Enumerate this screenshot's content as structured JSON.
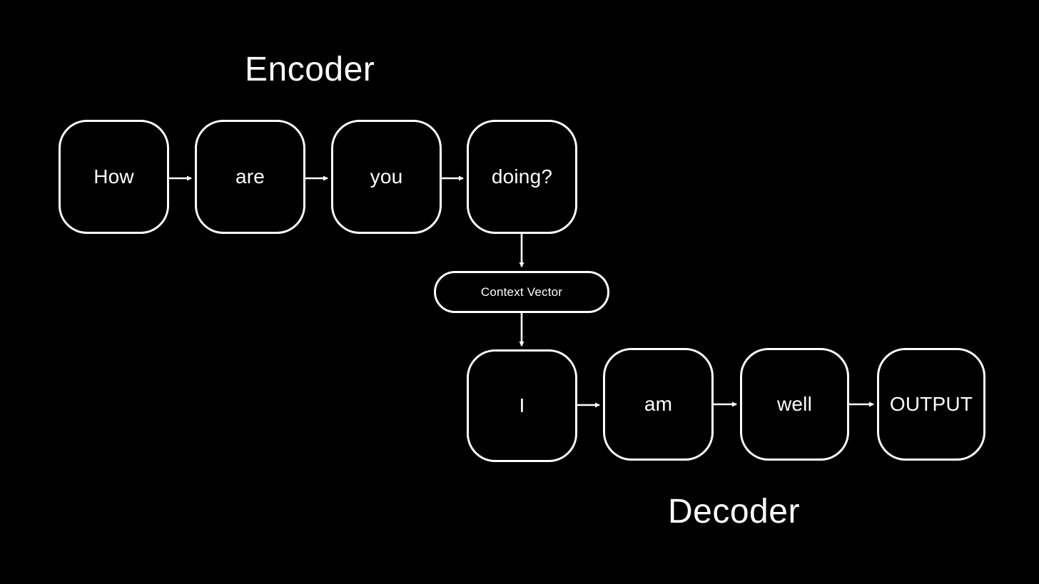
{
  "background_color": "#000000",
  "stroke_color": "#ffffff",
  "text_color": "#ffffff",
  "diagram": {
    "encoder": {
      "title": "Encoder",
      "nodes": [
        {
          "label": "How"
        },
        {
          "label": "are"
        },
        {
          "label": "you"
        },
        {
          "label": "doing?"
        }
      ]
    },
    "context": {
      "label": "Context Vector"
    },
    "decoder": {
      "title": "Decoder",
      "nodes": [
        {
          "label": "I"
        },
        {
          "label": "am"
        },
        {
          "label": "well"
        },
        {
          "label": "OUTPUT"
        }
      ]
    },
    "connections": [
      {
        "from": "How",
        "to": "are",
        "direction": "right"
      },
      {
        "from": "are",
        "to": "you",
        "direction": "right"
      },
      {
        "from": "you",
        "to": "doing?",
        "direction": "right"
      },
      {
        "from": "doing?",
        "to": "Context Vector",
        "direction": "down"
      },
      {
        "from": "Context Vector",
        "to": "I",
        "direction": "down"
      },
      {
        "from": "I",
        "to": "am",
        "direction": "right"
      },
      {
        "from": "am",
        "to": "well",
        "direction": "right"
      },
      {
        "from": "well",
        "to": "OUTPUT",
        "direction": "right"
      }
    ]
  }
}
